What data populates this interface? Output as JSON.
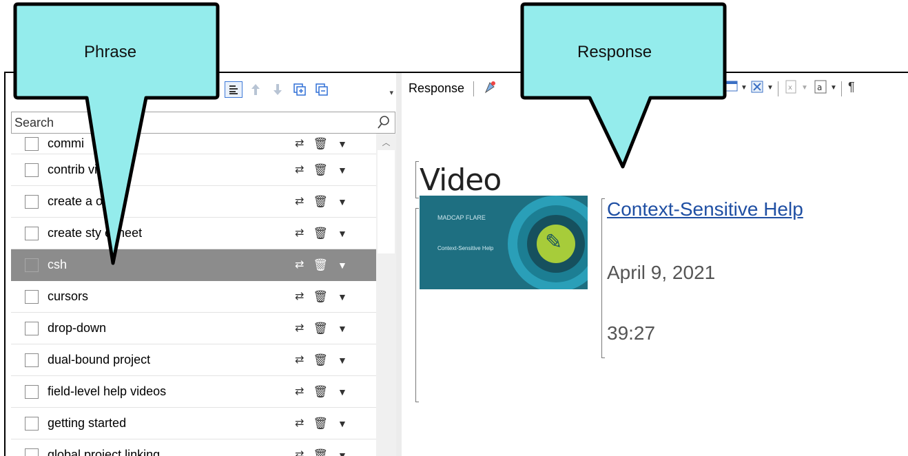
{
  "callouts": {
    "phrase": "Phrase",
    "response": "Response"
  },
  "phrase_pane": {
    "search_placeholder": "Search",
    "phrases": [
      {
        "label": "commi",
        "selected": false
      },
      {
        "label": "contrib     videos",
        "selected": false
      },
      {
        "label": "create a   oject",
        "selected": false
      },
      {
        "label": "create sty  esheet",
        "selected": false
      },
      {
        "label": "csh",
        "selected": true
      },
      {
        "label": "cursors",
        "selected": false
      },
      {
        "label": "drop-down",
        "selected": false
      },
      {
        "label": "dual-bound project",
        "selected": false
      },
      {
        "label": "field-level help videos",
        "selected": false
      },
      {
        "label": "getting started",
        "selected": false
      },
      {
        "label": "global project linking",
        "selected": false
      }
    ]
  },
  "response_pane": {
    "toolbar_label": "Response",
    "heading": "Video",
    "video": {
      "title": "Context-Sensitive Help",
      "date": "April 9, 2021",
      "duration": "39:27",
      "thumbnail_brand": "MADCAP FLARE",
      "thumbnail_subtitle": "Context-Sensitive Help"
    }
  },
  "colors": {
    "callout_fill": "#94ecec",
    "selected_row": "#8c8c8c",
    "link": "#1f4fa3",
    "thumbnail_bg": "#1e6f81",
    "accent_green": "#a7cc3a"
  }
}
